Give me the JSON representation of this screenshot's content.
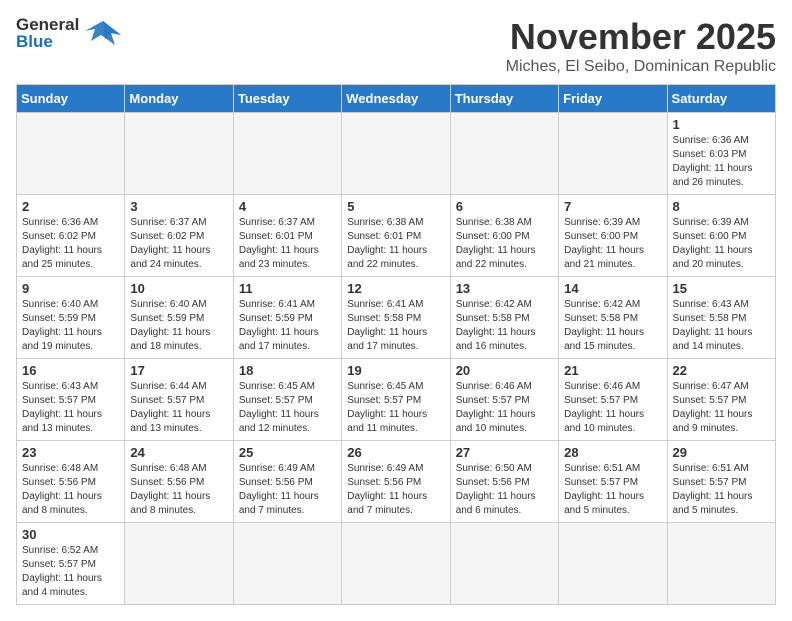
{
  "header": {
    "logo_general": "General",
    "logo_blue": "Blue",
    "month": "November 2025",
    "location": "Miches, El Seibo, Dominican Republic"
  },
  "days_of_week": [
    "Sunday",
    "Monday",
    "Tuesday",
    "Wednesday",
    "Thursday",
    "Friday",
    "Saturday"
  ],
  "weeks": [
    [
      {
        "day": "",
        "info": ""
      },
      {
        "day": "",
        "info": ""
      },
      {
        "day": "",
        "info": ""
      },
      {
        "day": "",
        "info": ""
      },
      {
        "day": "",
        "info": ""
      },
      {
        "day": "",
        "info": ""
      },
      {
        "day": "1",
        "info": "Sunrise: 6:36 AM\nSunset: 6:03 PM\nDaylight: 11 hours\nand 26 minutes."
      }
    ],
    [
      {
        "day": "2",
        "info": "Sunrise: 6:36 AM\nSunset: 6:02 PM\nDaylight: 11 hours\nand 25 minutes."
      },
      {
        "day": "3",
        "info": "Sunrise: 6:37 AM\nSunset: 6:02 PM\nDaylight: 11 hours\nand 24 minutes."
      },
      {
        "day": "4",
        "info": "Sunrise: 6:37 AM\nSunset: 6:01 PM\nDaylight: 11 hours\nand 23 minutes."
      },
      {
        "day": "5",
        "info": "Sunrise: 6:38 AM\nSunset: 6:01 PM\nDaylight: 11 hours\nand 22 minutes."
      },
      {
        "day": "6",
        "info": "Sunrise: 6:38 AM\nSunset: 6:00 PM\nDaylight: 11 hours\nand 22 minutes."
      },
      {
        "day": "7",
        "info": "Sunrise: 6:39 AM\nSunset: 6:00 PM\nDaylight: 11 hours\nand 21 minutes."
      },
      {
        "day": "8",
        "info": "Sunrise: 6:39 AM\nSunset: 6:00 PM\nDaylight: 11 hours\nand 20 minutes."
      }
    ],
    [
      {
        "day": "9",
        "info": "Sunrise: 6:40 AM\nSunset: 5:59 PM\nDaylight: 11 hours\nand 19 minutes."
      },
      {
        "day": "10",
        "info": "Sunrise: 6:40 AM\nSunset: 5:59 PM\nDaylight: 11 hours\nand 18 minutes."
      },
      {
        "day": "11",
        "info": "Sunrise: 6:41 AM\nSunset: 5:59 PM\nDaylight: 11 hours\nand 17 minutes."
      },
      {
        "day": "12",
        "info": "Sunrise: 6:41 AM\nSunset: 5:58 PM\nDaylight: 11 hours\nand 17 minutes."
      },
      {
        "day": "13",
        "info": "Sunrise: 6:42 AM\nSunset: 5:58 PM\nDaylight: 11 hours\nand 16 minutes."
      },
      {
        "day": "14",
        "info": "Sunrise: 6:42 AM\nSunset: 5:58 PM\nDaylight: 11 hours\nand 15 minutes."
      },
      {
        "day": "15",
        "info": "Sunrise: 6:43 AM\nSunset: 5:58 PM\nDaylight: 11 hours\nand 14 minutes."
      }
    ],
    [
      {
        "day": "16",
        "info": "Sunrise: 6:43 AM\nSunset: 5:57 PM\nDaylight: 11 hours\nand 13 minutes."
      },
      {
        "day": "17",
        "info": "Sunrise: 6:44 AM\nSunset: 5:57 PM\nDaylight: 11 hours\nand 13 minutes."
      },
      {
        "day": "18",
        "info": "Sunrise: 6:45 AM\nSunset: 5:57 PM\nDaylight: 11 hours\nand 12 minutes."
      },
      {
        "day": "19",
        "info": "Sunrise: 6:45 AM\nSunset: 5:57 PM\nDaylight: 11 hours\nand 11 minutes."
      },
      {
        "day": "20",
        "info": "Sunrise: 6:46 AM\nSunset: 5:57 PM\nDaylight: 11 hours\nand 10 minutes."
      },
      {
        "day": "21",
        "info": "Sunrise: 6:46 AM\nSunset: 5:57 PM\nDaylight: 11 hours\nand 10 minutes."
      },
      {
        "day": "22",
        "info": "Sunrise: 6:47 AM\nSunset: 5:57 PM\nDaylight: 11 hours\nand 9 minutes."
      }
    ],
    [
      {
        "day": "23",
        "info": "Sunrise: 6:48 AM\nSunset: 5:56 PM\nDaylight: 11 hours\nand 8 minutes."
      },
      {
        "day": "24",
        "info": "Sunrise: 6:48 AM\nSunset: 5:56 PM\nDaylight: 11 hours\nand 8 minutes."
      },
      {
        "day": "25",
        "info": "Sunrise: 6:49 AM\nSunset: 5:56 PM\nDaylight: 11 hours\nand 7 minutes."
      },
      {
        "day": "26",
        "info": "Sunrise: 6:49 AM\nSunset: 5:56 PM\nDaylight: 11 hours\nand 7 minutes."
      },
      {
        "day": "27",
        "info": "Sunrise: 6:50 AM\nSunset: 5:56 PM\nDaylight: 11 hours\nand 6 minutes."
      },
      {
        "day": "28",
        "info": "Sunrise: 6:51 AM\nSunset: 5:57 PM\nDaylight: 11 hours\nand 5 minutes."
      },
      {
        "day": "29",
        "info": "Sunrise: 6:51 AM\nSunset: 5:57 PM\nDaylight: 11 hours\nand 5 minutes."
      }
    ],
    [
      {
        "day": "30",
        "info": "Sunrise: 6:52 AM\nSunset: 5:57 PM\nDaylight: 11 hours\nand 4 minutes."
      },
      {
        "day": "",
        "info": ""
      },
      {
        "day": "",
        "info": ""
      },
      {
        "day": "",
        "info": ""
      },
      {
        "day": "",
        "info": ""
      },
      {
        "day": "",
        "info": ""
      },
      {
        "day": "",
        "info": ""
      }
    ]
  ]
}
